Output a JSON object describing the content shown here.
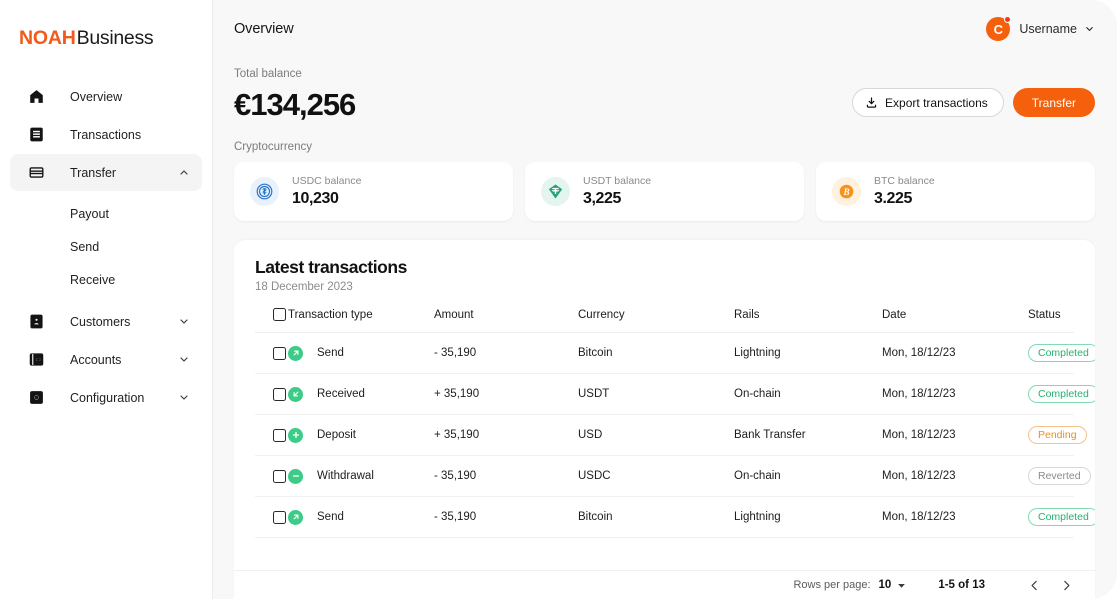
{
  "brand": {
    "name_primary": "NOAH",
    "name_secondary": "Business"
  },
  "sidebar": {
    "items": [
      {
        "label": "Overview",
        "icon": "home-icon",
        "type": "link"
      },
      {
        "label": "Transactions",
        "icon": "receipt-icon",
        "type": "link"
      },
      {
        "label": "Transfer",
        "icon": "card-icon",
        "type": "expandable",
        "expanded": true,
        "chevron": "chevron-up-icon"
      },
      {
        "label": "Customers",
        "icon": "user-icon",
        "type": "expandable",
        "expanded": false,
        "chevron": "chevron-down-icon"
      },
      {
        "label": "Accounts",
        "icon": "wallet-icon",
        "type": "expandable",
        "expanded": false,
        "chevron": "chevron-down-icon"
      },
      {
        "label": "Configuration",
        "icon": "gear-icon",
        "type": "expandable",
        "expanded": false,
        "chevron": "chevron-down-icon"
      }
    ],
    "transfer_sub_items": [
      {
        "label": "Payout"
      },
      {
        "label": "Send"
      },
      {
        "label": "Receive"
      }
    ]
  },
  "header": {
    "title": "Overview",
    "user": {
      "initial": "C",
      "name": "Username",
      "chevron": "chevron-down-icon",
      "avatar_color": "#F4600C",
      "badge_color": "#F4380C"
    }
  },
  "balance": {
    "label": "Total balance",
    "value": "€134,256",
    "export_button": "Export transactions",
    "export_icon": "download-icon",
    "transfer_button": "Transfer",
    "accent_color": "#F4600C"
  },
  "crypto": {
    "section_label": "Cryptocurrency",
    "cards": [
      {
        "label": "USDC balance",
        "value": "10,230",
        "icon": "usdc-icon",
        "icon_color": "#2775CA",
        "icon_bg": "#E8F1FC"
      },
      {
        "label": "USDT balance",
        "value": "3,225",
        "icon": "usdt-icon",
        "icon_color": "#26A17B",
        "icon_bg": "#E4F4EE"
      },
      {
        "label": "BTC balance",
        "value": "3.225",
        "icon": "btc-icon",
        "icon_color": "#F7931A",
        "icon_bg": "#FEF1E0"
      }
    ]
  },
  "transactions": {
    "title": "Latest transactions",
    "date": "18 December 2023",
    "columns": [
      "Transaction type",
      "Amount",
      "Currency",
      "Rails",
      "Date",
      "Status"
    ],
    "rows": [
      {
        "icon": "arrow-up-right-icon",
        "type": "Send",
        "amount": "- 35,190",
        "currency": "Bitcoin",
        "rails": "Lightning",
        "date": "Mon, 18/12/23",
        "status": "Completed",
        "status_kind": "completed"
      },
      {
        "icon": "arrow-down-left-icon",
        "type": "Received",
        "amount": "+ 35,190",
        "currency": "USDT",
        "rails": "On-chain",
        "date": "Mon, 18/12/23",
        "status": "Completed",
        "status_kind": "completed"
      },
      {
        "icon": "plus-icon",
        "type": "Deposit",
        "amount": "+ 35,190",
        "currency": "USD",
        "rails": "Bank Transfer",
        "date": "Mon, 18/12/23",
        "status": "Pending",
        "status_kind": "pending"
      },
      {
        "icon": "minus-icon",
        "type": "Withdrawal",
        "amount": "- 35,190",
        "currency": "USDC",
        "rails": "On-chain",
        "date": "Mon, 18/12/23",
        "status": "Reverted",
        "status_kind": "reverted"
      },
      {
        "icon": "arrow-up-right-icon",
        "type": "Send",
        "amount": "- 35,190",
        "currency": "Bitcoin",
        "rails": "Lightning",
        "date": "Mon, 18/12/23",
        "status": "Completed",
        "status_kind": "completed"
      }
    ]
  },
  "pagination": {
    "rows_label": "Rows per page:",
    "rows_value": "10",
    "caret_icon": "caret-down-icon",
    "range": "1-5 of 13",
    "prev_icon": "chevron-left-icon",
    "next_icon": "chevron-right-icon"
  }
}
